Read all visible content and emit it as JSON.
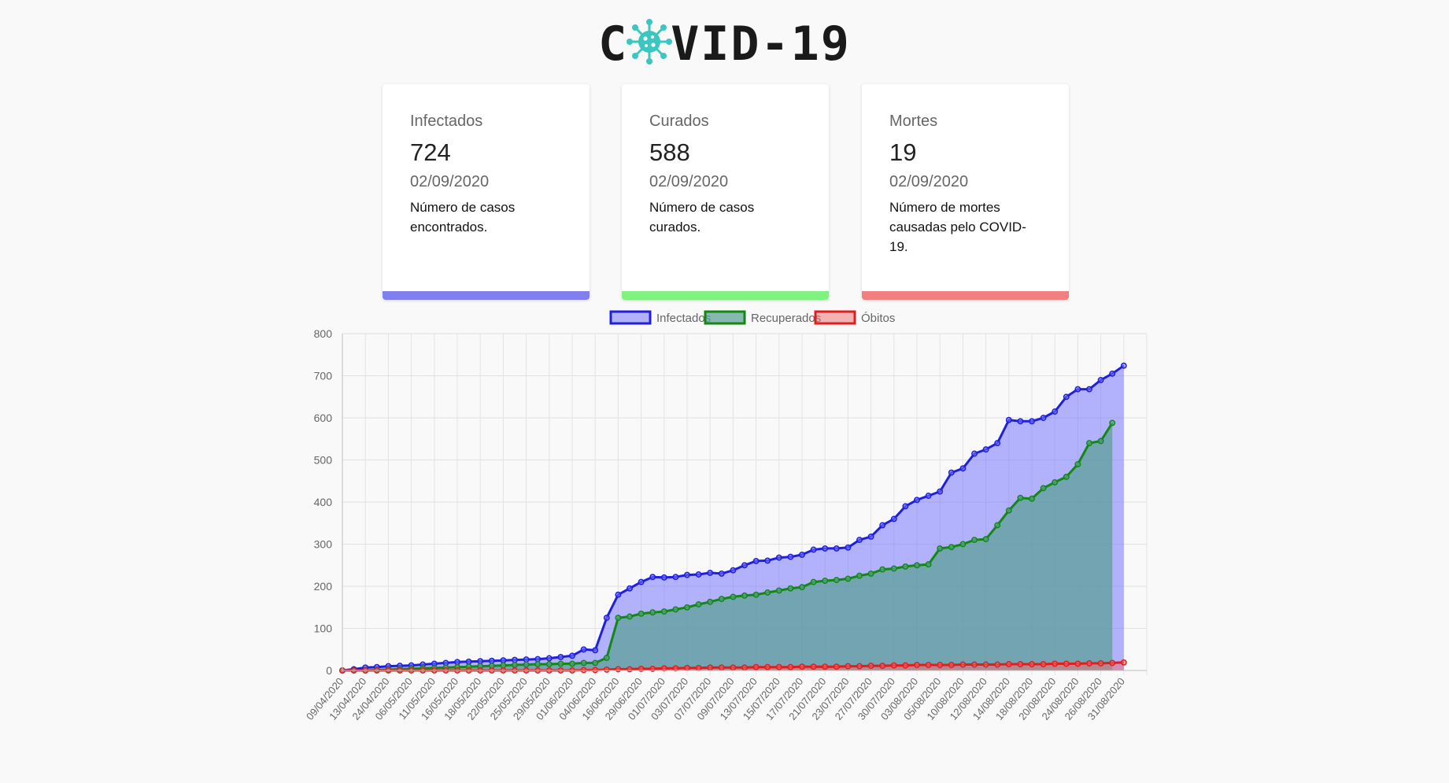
{
  "header": {
    "title_left": "C",
    "title_right": "VID-19"
  },
  "cards": [
    {
      "label": "Infectados",
      "value": "724",
      "date": "02/09/2020",
      "description": "Número de casos encontrados.",
      "color": "#7f7fef"
    },
    {
      "label": "Curados",
      "value": "588",
      "date": "02/09/2020",
      "description": "Número de casos curados.",
      "color": "#7ff27f"
    },
    {
      "label": "Mortes",
      "value": "19",
      "date": "02/09/2020",
      "description": "Número de mortes causadas pelo COVID-19.",
      "color": "#f27f7f"
    }
  ],
  "chart_data": {
    "type": "area",
    "x": [
      "09/04/2020",
      "",
      "13/04/2020",
      "",
      "24/04/2020",
      "",
      "06/05/2020",
      "",
      "11/05/2020",
      "",
      "16/05/2020",
      "",
      "18/05/2020",
      "",
      "22/05/2020",
      "",
      "25/05/2020",
      "",
      "29/05/2020",
      "",
      "01/06/2020",
      "",
      "04/06/2020",
      "",
      "16/06/2020",
      "",
      "29/06/2020",
      "",
      "01/07/2020",
      "",
      "03/07/2020",
      "",
      "07/07/2020",
      "",
      "09/07/2020",
      "",
      "13/07/2020",
      "",
      "15/07/2020",
      "",
      "17/07/2020",
      "",
      "21/07/2020",
      "",
      "23/07/2020",
      "",
      "27/07/2020",
      "",
      "30/07/2020",
      "",
      "03/08/2020",
      "",
      "05/08/2020",
      "",
      "10/08/2020",
      "",
      "12/08/2020",
      "",
      "14/08/2020",
      "",
      "18/08/2020",
      "",
      "20/08/2020",
      "",
      "24/08/2020",
      "",
      "26/08/2020",
      "",
      "31/08/2020",
      "",
      ""
    ],
    "series": [
      {
        "name": "Infectados",
        "color": "#1f1fdf",
        "fill": "rgba(118,118,255,0.55)",
        "values": [
          0,
          3,
          7,
          8,
          10,
          11,
          12,
          14,
          16,
          18,
          20,
          21,
          22,
          23,
          24,
          25,
          26,
          27,
          29,
          32,
          35,
          50,
          48,
          125,
          180,
          195,
          210,
          222,
          221,
          222,
          227,
          228,
          232,
          230,
          238,
          250,
          260,
          261,
          268,
          270,
          275,
          287,
          290,
          290,
          292,
          310,
          318,
          345,
          360,
          390,
          405,
          415,
          425,
          470,
          480,
          515,
          525,
          540,
          595,
          592,
          592,
          600,
          615,
          650,
          668,
          668,
          690,
          705,
          724
        ]
      },
      {
        "name": "Recuperados",
        "color": "#138813",
        "fill": "rgba(90,160,150,0.72)",
        "values": [
          0,
          0,
          0,
          1,
          2,
          3,
          4,
          5,
          6,
          7,
          8,
          9,
          10,
          11,
          12,
          13,
          14,
          15,
          15,
          16,
          16,
          18,
          18,
          30,
          125,
          128,
          135,
          138,
          140,
          145,
          150,
          157,
          163,
          170,
          175,
          178,
          180,
          185,
          190,
          195,
          198,
          210,
          213,
          215,
          218,
          225,
          230,
          240,
          242,
          247,
          250,
          252,
          290,
          293,
          300,
          310,
          312,
          345,
          380,
          410,
          408,
          433,
          447,
          460,
          490,
          540,
          545,
          588
        ]
      },
      {
        "name": "Óbitos",
        "color": "#e21d1d",
        "fill": "rgba(240,110,110,0.5)",
        "values": [
          0,
          0,
          0,
          0,
          0,
          0,
          0,
          0,
          0,
          0,
          0,
          0,
          0,
          0,
          0,
          0,
          0,
          0,
          0,
          0,
          0,
          1,
          1,
          2,
          3,
          3,
          4,
          4,
          5,
          5,
          6,
          6,
          7,
          7,
          7,
          7,
          8,
          8,
          8,
          8,
          9,
          9,
          9,
          9,
          10,
          10,
          11,
          11,
          12,
          12,
          13,
          13,
          13,
          13,
          14,
          14,
          14,
          14,
          15,
          15,
          15,
          15,
          16,
          16,
          16,
          17,
          17,
          18,
          19
        ]
      }
    ],
    "ylim": [
      0,
      800
    ],
    "yticks": [
      0,
      100,
      200,
      300,
      400,
      500,
      600,
      700,
      800
    ],
    "grid": true,
    "legend": "top-center"
  }
}
